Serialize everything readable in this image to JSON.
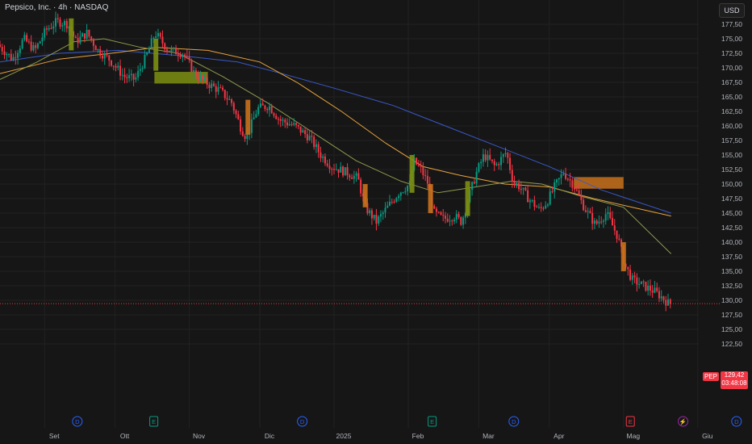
{
  "title": "Pepsico, Inc. · 4h · NASDAQ",
  "currency": "USD",
  "ticker": "PEP",
  "last_price": "129,42",
  "countdown": "03:48:08",
  "colors": {
    "background": "#161616",
    "up": "#089981",
    "down": "#f23645",
    "ma_blue": "#3959c9",
    "ma_orange": "#e8a33d",
    "ma_olive": "#8f9a4e",
    "zone_green": "#7c8f12",
    "zone_orange": "#c9711b"
  },
  "chart_data": {
    "type": "candlestick",
    "y_axis": {
      "range": [
        122.5,
        180
      ],
      "ticks": [
        "177,50",
        "175,00",
        "172,50",
        "170,00",
        "167,50",
        "165,00",
        "162,50",
        "160,00",
        "157,50",
        "155,00",
        "152,50",
        "150,00",
        "147,50",
        "145,00",
        "142,50",
        "140,00",
        "137,50",
        "135,00",
        "132,50",
        "130,00",
        "127,50",
        "125,00",
        "122,50"
      ]
    },
    "x_axis": {
      "labels": [
        "Set",
        "Ott",
        "Nov",
        "Dic",
        "2025",
        "Feb",
        "Mar",
        "Apr",
        "Mag",
        "Giu"
      ],
      "label_t": [
        0.6,
        1.55,
        2.55,
        3.5,
        4.5,
        5.5,
        6.45,
        7.4,
        8.4,
        9.4
      ]
    },
    "price_path": [
      [
        0,
        174
      ],
      [
        0.2,
        171.5
      ],
      [
        0.35,
        175
      ],
      [
        0.5,
        173
      ],
      [
        0.65,
        176.5
      ],
      [
        0.8,
        178
      ],
      [
        0.95,
        177.5
      ],
      [
        1.05,
        174.5
      ],
      [
        1.2,
        176
      ],
      [
        1.35,
        173
      ],
      [
        1.5,
        171.5
      ],
      [
        1.7,
        168.5
      ],
      [
        1.85,
        168
      ],
      [
        2.0,
        172
      ],
      [
        2.12,
        176
      ],
      [
        2.3,
        173
      ],
      [
        2.5,
        172.5
      ],
      [
        2.65,
        169
      ],
      [
        2.8,
        167.5
      ],
      [
        3.0,
        166
      ],
      [
        3.15,
        164
      ],
      [
        3.28,
        159.5
      ],
      [
        3.35,
        158
      ],
      [
        3.5,
        163
      ],
      [
        3.65,
        163.5
      ],
      [
        3.8,
        161
      ],
      [
        4.0,
        160
      ],
      [
        4.2,
        158
      ],
      [
        4.35,
        155
      ],
      [
        4.5,
        153
      ],
      [
        4.7,
        152
      ],
      [
        4.85,
        151
      ],
      [
        4.95,
        146
      ],
      [
        5.1,
        143.5
      ],
      [
        5.25,
        146
      ],
      [
        5.4,
        148.5
      ],
      [
        5.55,
        150
      ],
      [
        5.6,
        154
      ],
      [
        5.7,
        152.5
      ],
      [
        5.8,
        150
      ],
      [
        5.88,
        145
      ],
      [
        6.0,
        144
      ],
      [
        6.15,
        144.5
      ],
      [
        6.25,
        143.5
      ],
      [
        6.35,
        148
      ],
      [
        6.45,
        152
      ],
      [
        6.55,
        155
      ],
      [
        6.7,
        153
      ],
      [
        6.85,
        155.5
      ],
      [
        6.95,
        150
      ],
      [
        7.0,
        150
      ],
      [
        7.15,
        147.5
      ],
      [
        7.3,
        145.5
      ],
      [
        7.4,
        147
      ],
      [
        7.5,
        149.5
      ],
      [
        7.62,
        152
      ],
      [
        7.75,
        150
      ],
      [
        7.9,
        146
      ],
      [
        8.05,
        143
      ],
      [
        8.2,
        145
      ],
      [
        8.35,
        141
      ],
      [
        8.45,
        136
      ],
      [
        8.55,
        133.5
      ],
      [
        8.7,
        132.5
      ],
      [
        8.85,
        131.5
      ],
      [
        8.95,
        130.5
      ],
      [
        9.04,
        129.4
      ]
    ],
    "moving_averages": [
      {
        "color": "blue",
        "points": [
          [
            0,
            171
          ],
          [
            0.8,
            172.5
          ],
          [
            1.6,
            173
          ],
          [
            2.5,
            172
          ],
          [
            3.2,
            171
          ],
          [
            3.8,
            169
          ],
          [
            4.5,
            166.5
          ],
          [
            5.3,
            163.5
          ],
          [
            6.0,
            160
          ],
          [
            6.7,
            156.5
          ],
          [
            7.4,
            153
          ],
          [
            8.1,
            149
          ],
          [
            9.04,
            145
          ]
        ]
      },
      {
        "color": "orange",
        "points": [
          [
            0,
            169
          ],
          [
            0.8,
            171.5
          ],
          [
            1.5,
            172.5
          ],
          [
            2.1,
            173.5
          ],
          [
            2.8,
            173
          ],
          [
            3.5,
            171
          ],
          [
            4.0,
            167.5
          ],
          [
            4.6,
            162.5
          ],
          [
            5.2,
            157
          ],
          [
            5.7,
            153
          ],
          [
            6.2,
            151.5
          ],
          [
            6.8,
            150
          ],
          [
            7.4,
            149.5
          ],
          [
            8.0,
            147.5
          ],
          [
            9.04,
            144.5
          ]
        ]
      },
      {
        "color": "olive",
        "points": [
          [
            0,
            168
          ],
          [
            0.5,
            171
          ],
          [
            1.0,
            174.5
          ],
          [
            1.4,
            175
          ],
          [
            1.9,
            173.5
          ],
          [
            2.4,
            172.5
          ],
          [
            3.0,
            168.5
          ],
          [
            3.6,
            164
          ],
          [
            4.2,
            159
          ],
          [
            4.8,
            154
          ],
          [
            5.4,
            150.5
          ],
          [
            5.9,
            148.5
          ],
          [
            6.4,
            149.5
          ],
          [
            6.9,
            150.5
          ],
          [
            7.3,
            150
          ],
          [
            7.8,
            148
          ],
          [
            8.4,
            146
          ],
          [
            9.04,
            138
          ]
        ]
      }
    ],
    "zones": [
      {
        "color": "green",
        "t": [
          2.08,
          2.8
        ],
        "y": [
          167.3,
          169.3
        ]
      },
      {
        "color": "orange",
        "t": [
          7.73,
          8.4
        ],
        "y": [
          149.2,
          151.2
        ]
      }
    ],
    "highlight_candles": [
      {
        "color": "green",
        "t": 0.96,
        "y": [
          173,
          178.5
        ]
      },
      {
        "color": "green",
        "t": 2.1,
        "y": [
          169.5,
          175
        ]
      },
      {
        "color": "orange",
        "t": 3.34,
        "y": [
          158.5,
          164.5
        ]
      },
      {
        "color": "orange",
        "t": 4.92,
        "y": [
          146,
          150
        ]
      },
      {
        "color": "green",
        "t": 5.55,
        "y": [
          148.5,
          155
        ]
      },
      {
        "color": "orange",
        "t": 5.8,
        "y": [
          145,
          150
        ]
      },
      {
        "color": "green",
        "t": 6.3,
        "y": [
          144.5,
          150.5
        ]
      },
      {
        "color": "orange",
        "t": 8.4,
        "y": [
          135,
          140
        ]
      }
    ],
    "events": [
      {
        "letter": "D",
        "kind": "dividend",
        "t": 1.02
      },
      {
        "letter": "E",
        "kind": "earnings",
        "t": 2.05
      },
      {
        "letter": "D",
        "kind": "dividend",
        "t": 4.05
      },
      {
        "letter": "E",
        "kind": "earnings",
        "t": 5.8
      },
      {
        "letter": "D",
        "kind": "dividend",
        "t": 6.9
      },
      {
        "letter": "E",
        "kind": "earnings",
        "t": 8.47
      },
      {
        "letter": "⚡",
        "kind": "flash",
        "t": 9.18
      },
      {
        "letter": "D",
        "kind": "dividend",
        "t": 9.9
      }
    ],
    "last_price": 129.42,
    "grid": true
  }
}
